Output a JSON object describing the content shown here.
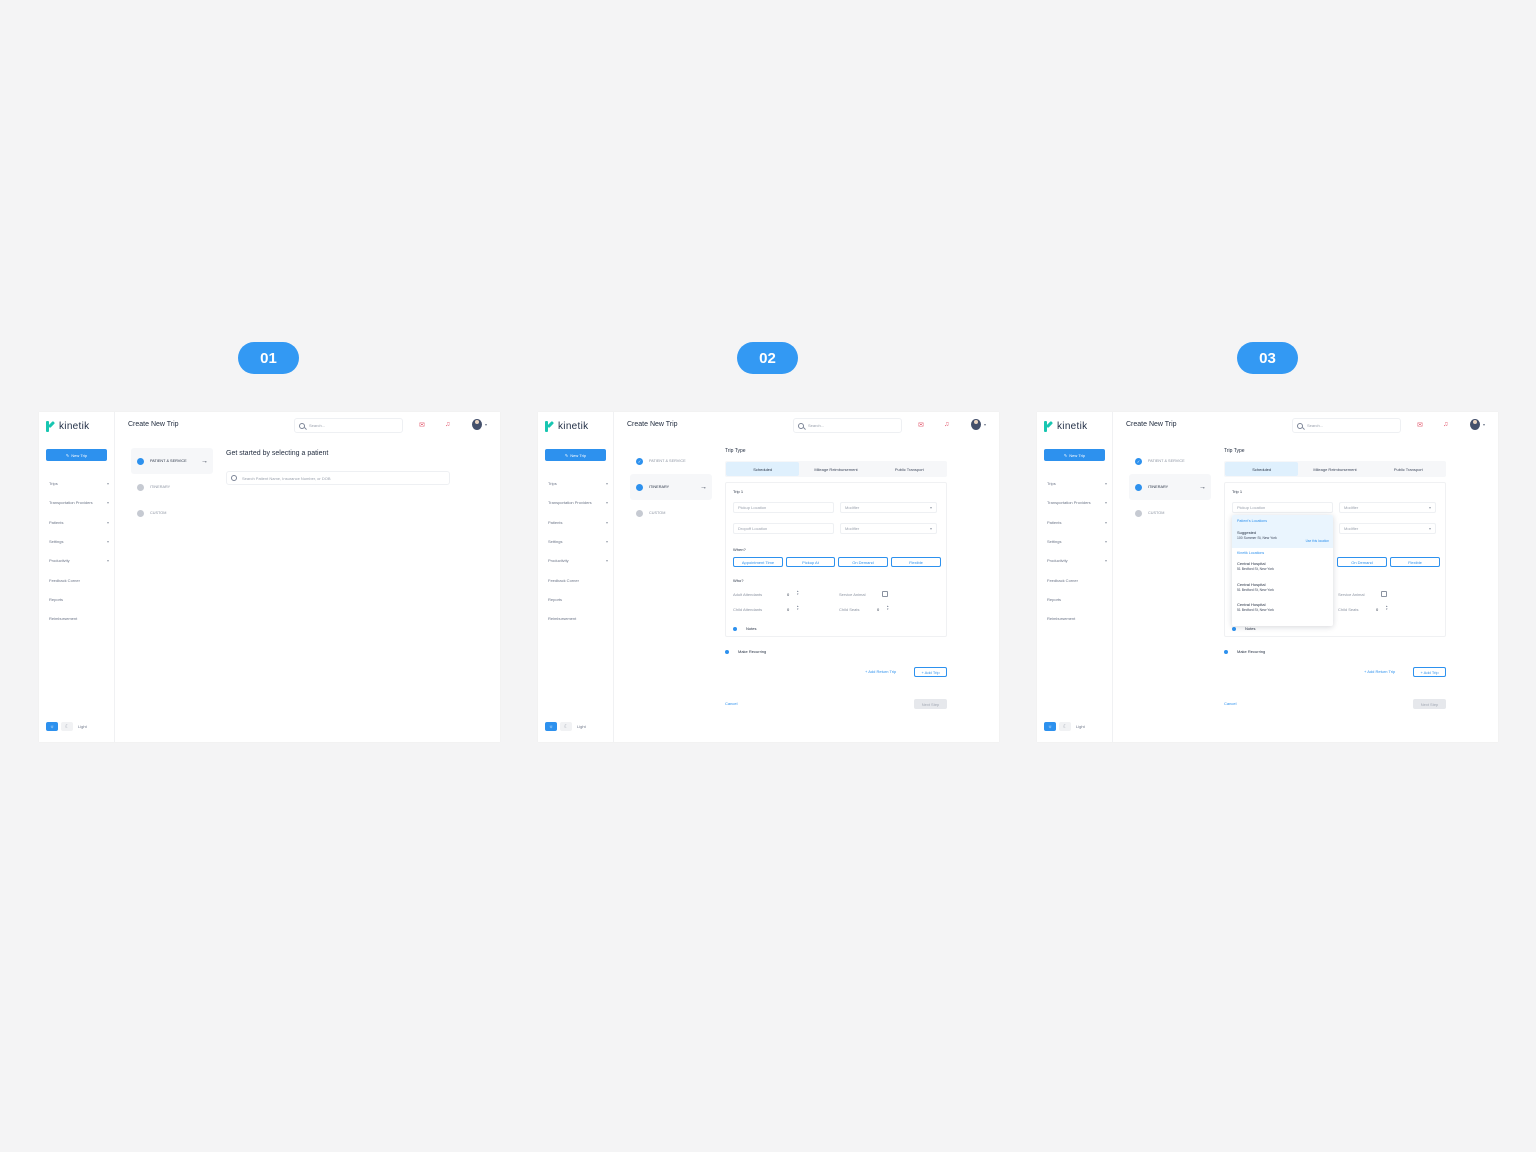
{
  "badges": [
    "01",
    "02",
    "03"
  ],
  "app": {
    "logo_text": "kinetik",
    "new_trip_label": "New Trip",
    "page_title": "Create New Trip",
    "search_placeholder": "Search...",
    "sidebar_items": [
      "Trips",
      "Transportation Providers",
      "Patients",
      "Settings",
      "Productivity",
      "Feedback Corner",
      "Reports",
      "Reimbursement"
    ],
    "theme_label": "Light"
  },
  "stepper": [
    "PATIENT & SERVICE",
    "ITINERARY",
    "CUSTOM"
  ],
  "frame1": {
    "heading": "Get started by selecting a patient",
    "search_placeholder": "Search Patient Name, Insurance Number, or DOB"
  },
  "form": {
    "trip_type_label": "Trip Type",
    "tabs": [
      "Scheduled",
      "Mileage Reimbursement",
      "Public Transport"
    ],
    "trip_label": "Trip 1",
    "pickup_placeholder": "Pickup Location",
    "dropoff_placeholder": "Dropoff Location",
    "modifier_placeholder": "Modifier",
    "when_label": "When?",
    "when_options": [
      "Appointment Time",
      "Pickup At",
      "On Demand",
      "Flexible"
    ],
    "who_label": "Who?",
    "adult_label": "Adult Attendants",
    "child_label": "Child Attendants",
    "service_animal_label": "Service Animal",
    "child_seats_label": "Child Seats",
    "adult_value": "0",
    "child_value": "0",
    "child_seats_value": "0",
    "notes_label": "Notes",
    "recurring_label": "Make Recurring",
    "add_return_label": "+ Add Return Trip",
    "add_trip_label": "+ Add Trip",
    "cancel_label": "Cancel",
    "next_label": "Next Step"
  },
  "dropdown": {
    "patients_header": "Patient's Locations",
    "suggested_title": "Suggested",
    "suggested_address": "100 Summer St, New York",
    "use_label": "Use this location",
    "kinetik_header": "Kinetik Locations",
    "items": [
      {
        "name": "Central Hospital",
        "address": "51 Bedford St, New York"
      },
      {
        "name": "Central Hospital",
        "address": "51 Bedford St, New York"
      },
      {
        "name": "Central Hospital",
        "address": "51 Bedford St, New York"
      }
    ]
  },
  "colors": {
    "accent": "#2d91ee",
    "badge": "#3399f3",
    "logo": "#18c6b1",
    "alert": "#e2556b"
  }
}
